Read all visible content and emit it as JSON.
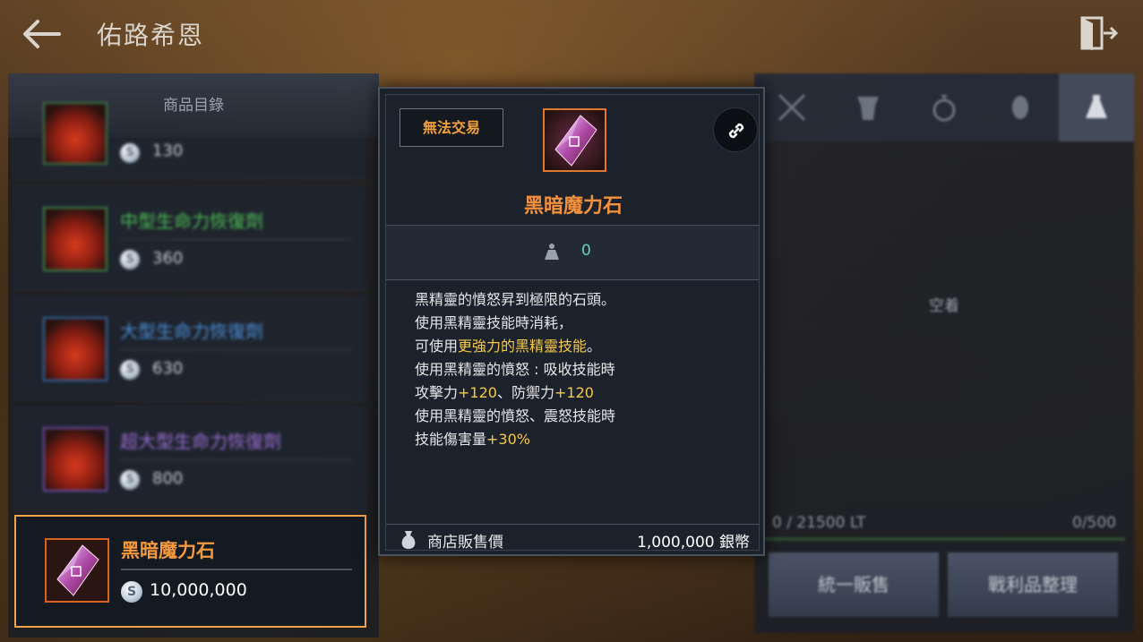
{
  "header": {
    "title": "佑路希恩"
  },
  "shop_list": {
    "header": "商品目錄",
    "items": [
      {
        "name": "",
        "price": "130",
        "name_color": "#4fbf55"
      },
      {
        "name": "中型生命力恢復劑",
        "price": "360",
        "name_color": "#4fbf55"
      },
      {
        "name": "大型生命力恢復劑",
        "price": "630",
        "name_color": "#4a8fd8"
      },
      {
        "name": "超大型生命力恢復劑",
        "price": "800",
        "name_color": "#9c6fd6"
      }
    ],
    "selected": {
      "name": "黑暗魔力石",
      "price": "10,000,000"
    }
  },
  "coin_symbol": "S",
  "tooltip": {
    "trade_badge": "無法交易",
    "item_name": "黑暗魔力石",
    "weight": "0",
    "description": {
      "line1": "黑精靈的憤怒昇到極限的石頭。",
      "line2": "使用黑精靈技能時消耗，",
      "line3_pre": "可使用",
      "line3_hl": "更強力的黑精靈技能",
      "line3_post": "。",
      "line4": "使用黑精靈的憤怒 : 吸收技能時",
      "line5_a": "攻擊力",
      "line5_b": "+120",
      "line5_c": "、防禦力",
      "line5_d": "+120",
      "line6": "使用黑精靈的憤怒、震怒技能時",
      "line7_a": "技能傷害量",
      "line7_b": "+30%"
    },
    "shop_price_label": "商店販售價",
    "shop_price_value": "1,000,000 銀幣"
  },
  "inventory": {
    "tabs": [
      "weapon-tab",
      "armor-tab",
      "accessory-tab",
      "misc-tab",
      "potion-tab"
    ],
    "active_tab": 4,
    "empty_text": "空着",
    "weight": "0 / 21500 LT",
    "count": "0/500",
    "sell_all_button": "統一販售",
    "sort_button": "戰利品整理"
  },
  "colors": {
    "accent_orange": "#f5913a",
    "highlight_yellow": "#f7c948",
    "weight_teal": "#5fd3c8",
    "selected_border": "#f5a24a"
  }
}
